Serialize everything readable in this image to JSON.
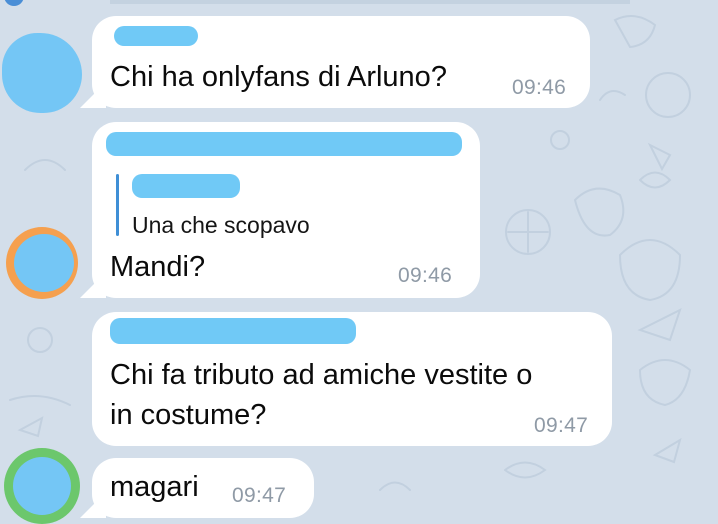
{
  "messages": [
    {
      "text": "Chi ha onlyfans di Arluno?",
      "time": "09:46"
    },
    {
      "reply_text": "Una che scopavo",
      "text": "Mandi?",
      "time": "09:46"
    },
    {
      "text_line1": "Chi fa tributo ad amiche vestite o",
      "text_line2": "in costume?",
      "time": "09:47"
    },
    {
      "text": "magari",
      "time": "09:47"
    }
  ],
  "colors": {
    "chat_background": "#d3deea",
    "bubble": "#ffffff",
    "redaction": "#70c9f6",
    "reply_bar": "#3f8fd6",
    "timestamp": "#8f9aa6"
  },
  "icons": [
    "avatar",
    "reply-quote-bar"
  ]
}
